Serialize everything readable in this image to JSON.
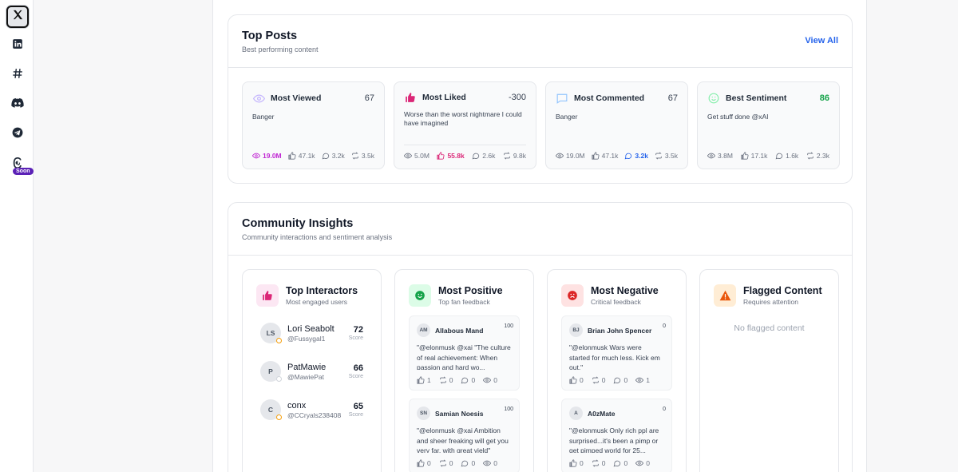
{
  "rail": {
    "items": [
      {
        "icon": "x-icon"
      },
      {
        "icon": "linkedin-icon"
      },
      {
        "icon": "hashtag-icon"
      },
      {
        "icon": "discord-icon"
      },
      {
        "icon": "telegram-icon"
      },
      {
        "icon": "threads-icon",
        "badge": "Soon"
      }
    ]
  },
  "top_posts": {
    "title": "Top Posts",
    "subtitle": "Best performing content",
    "view_all": "View All",
    "cards": [
      {
        "label": "Most Viewed",
        "value": "67",
        "text": "Banger",
        "views": "19.0M",
        "likes": "47.1k",
        "comments": "3.2k",
        "reposts": "3.5k",
        "highlight": "views",
        "accent": "#c026d3",
        "icon": "eye-icon"
      },
      {
        "label": "Most Liked",
        "value": "-300",
        "text": "Worse than the worst nightmare I could have imagined",
        "views": "5.0M",
        "likes": "55.8k",
        "comments": "2.6k",
        "reposts": "9.8k",
        "highlight": "likes",
        "accent": "#db2777",
        "icon": "thumbs-up-icon"
      },
      {
        "label": "Most Commented",
        "value": "67",
        "text": "Banger",
        "views": "19.0M",
        "likes": "47.1k",
        "comments": "3.2k",
        "reposts": "3.5k",
        "highlight": "comments",
        "accent": "#2563eb",
        "icon": "comment-icon"
      },
      {
        "label": "Best Sentiment",
        "value": "86",
        "text": "Get stuff done @xAI",
        "views": "3.8M",
        "likes": "17.1k",
        "comments": "1.6k",
        "reposts": "2.3k",
        "highlight": "value",
        "accent": "#16a34a",
        "icon": "smile-icon"
      }
    ]
  },
  "community": {
    "title": "Community Insights",
    "subtitle": "Community interactions and sentiment analysis",
    "top_interactors": {
      "title": "Top Interactors",
      "subtitle": "Most engaged users",
      "score_label": "Score",
      "users": [
        {
          "initials": "LS",
          "name": "Lori Seabolt",
          "handle": "@Fussygal1",
          "score": "72"
        },
        {
          "initials": "P",
          "name": "PatMawie",
          "handle": "@MawiePat",
          "score": "66"
        },
        {
          "initials": "C",
          "name": "conx",
          "handle": "@CCryals238408",
          "score": "65"
        }
      ]
    },
    "most_positive": {
      "title": "Most Positive",
      "subtitle": "Top fan feedback",
      "items": [
        {
          "initials": "AM",
          "name": "Allabous Mand",
          "score": "100",
          "text": "\"@elonmusk @xai \"The culture of real achievement: When passion and hard wo...",
          "likes": "1",
          "reposts": "0",
          "comments": "0",
          "views": "0"
        },
        {
          "initials": "SN",
          "name": "Samian Noesis",
          "score": "100",
          "text": "\"@elonmusk @xai Ambition and sheer freaking will get you very far, with great yield\"",
          "likes": "0",
          "reposts": "0",
          "comments": "0",
          "views": "0"
        }
      ]
    },
    "most_negative": {
      "title": "Most Negative",
      "subtitle": "Critical feedback",
      "items": [
        {
          "initials": "BJ",
          "name": "Brian John Spencer",
          "score": "0",
          "text": "\"@elonmusk Wars were started for much less. Kick em out.\"",
          "likes": "0",
          "reposts": "0",
          "comments": "0",
          "views": "1"
        },
        {
          "initials": "A",
          "name": "A0zMate",
          "score": "0",
          "text": "\"@elonmusk Only rich ppl are surprised...it's been a pimp or get pimped world for 25...",
          "likes": "0",
          "reposts": "0",
          "comments": "0",
          "views": "0"
        }
      ]
    },
    "flagged": {
      "title": "Flagged Content",
      "subtitle": "Requires attention",
      "empty_text": "No flagged content"
    }
  }
}
